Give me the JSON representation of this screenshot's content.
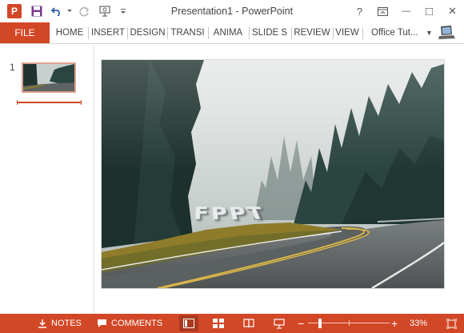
{
  "window": {
    "title": "Presentation1 - PowerPoint",
    "app_logo_letter": "P",
    "controls": [
      "help-icon",
      "ribbon-display-icon",
      "minimize-icon",
      "maximize-icon",
      "close-icon"
    ],
    "help_label": "?",
    "minimize_label": "—",
    "maximize_label": "□",
    "close_label": "✕"
  },
  "quick_access": [
    "save-icon",
    "undo-icon",
    "redo-icon",
    "start-from-beginning-icon",
    "customize-icon"
  ],
  "ribbon": {
    "file_label": "FILE",
    "tabs": [
      "HOME",
      "INSERT",
      "DESIGN",
      "TRANSI",
      "ANIMA",
      "SLIDE S",
      "REVIEW",
      "VIEW"
    ],
    "user_name": "Office Tut...",
    "accent": "#d24726"
  },
  "thumbnails": {
    "slide_number": "1"
  },
  "slide": {
    "wordart_text": "FPPT"
  },
  "statusbar": {
    "notes_label": "NOTES",
    "comments_label": "COMMENTS",
    "zoom_minus": "−",
    "zoom_plus": "+",
    "zoom_level": "33%",
    "zoom_fraction": 0.33
  }
}
